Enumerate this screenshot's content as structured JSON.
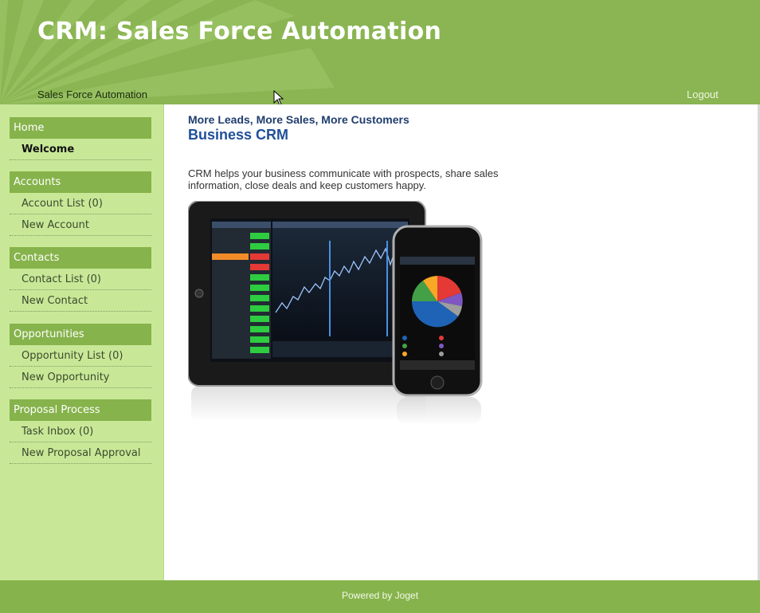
{
  "header": {
    "title": "CRM: Sales Force Automation",
    "subtitle": "Sales Force Automation",
    "logout_label": "Logout"
  },
  "sidebar": {
    "sections": [
      {
        "title": "Home",
        "items": [
          {
            "label": "Welcome",
            "active": true
          }
        ]
      },
      {
        "title": "Accounts",
        "items": [
          {
            "label": "Account List (0)"
          },
          {
            "label": "New Account"
          }
        ]
      },
      {
        "title": "Contacts",
        "items": [
          {
            "label": "Contact List (0)"
          },
          {
            "label": "New Contact"
          }
        ]
      },
      {
        "title": "Opportunities",
        "items": [
          {
            "label": "Opportunity List (0)"
          },
          {
            "label": "New Opportunity"
          }
        ]
      },
      {
        "title": "Proposal Process",
        "items": [
          {
            "label": "Task Inbox (0)"
          },
          {
            "label": "New Proposal Approval"
          }
        ]
      }
    ]
  },
  "content": {
    "tagline": "More Leads, More Sales, More Customers",
    "title": "Business CRM",
    "intro": "CRM helps your business communicate with prospects, share sales information, close deals and keep customers happy.",
    "image_alt": "tablet-and-phone-showing-crm-analytics"
  },
  "footer": {
    "text": "Powered by Joget"
  },
  "colors": {
    "header": "#8ab552",
    "sidebar": "#c8e898",
    "section_head": "#86b34b",
    "footer": "#86b34b",
    "title_blue": "#1f4f99"
  }
}
